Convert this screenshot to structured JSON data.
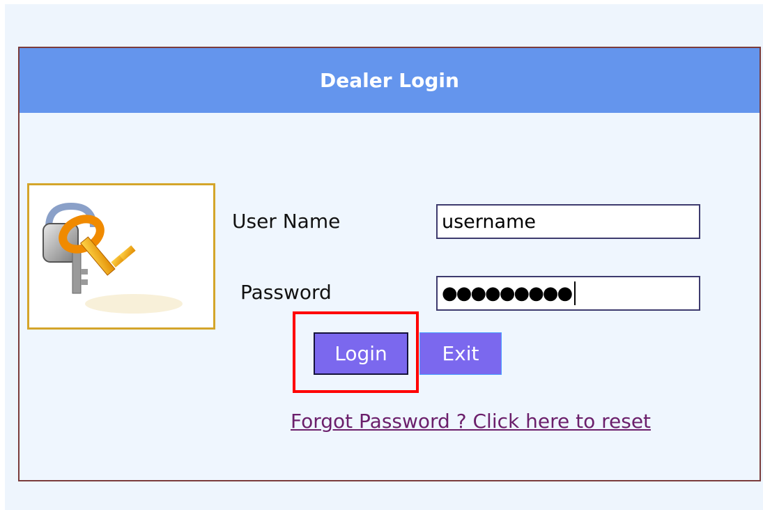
{
  "header": {
    "title": "Dealer Login"
  },
  "form": {
    "username_label": "User Name",
    "username_value": "username",
    "password_label": "Password",
    "password_value": "●●●●●●●●●",
    "login_button": "Login",
    "exit_button": "Exit",
    "reset_link": "Forgot Password ? Click here to reset"
  },
  "icons": {
    "login_image": "keys-icon"
  },
  "colors": {
    "header_bg": "#6495ed",
    "button_bg": "#7b68ee",
    "highlight": "#ff0000",
    "link": "#6b1f6b"
  }
}
